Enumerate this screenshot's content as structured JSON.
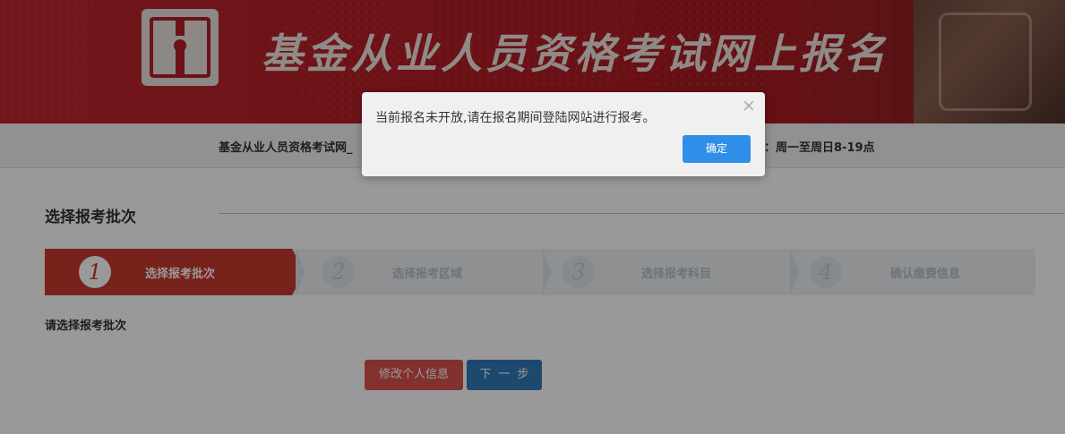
{
  "banner": {
    "title": "基金从业人员资格考试网上报名"
  },
  "infobar": {
    "left_text": "基金从业人员资格考试网_",
    "right_text": "服：周一至周日8-19点"
  },
  "section": {
    "title": "选择报考批次"
  },
  "steps": [
    {
      "num": "1",
      "label": "选择报考批次",
      "active": true
    },
    {
      "num": "2",
      "label": "选择报考区域",
      "active": false
    },
    {
      "num": "3",
      "label": "选择报考科目",
      "active": false
    },
    {
      "num": "4",
      "label": "确认缴费信息",
      "active": false
    }
  ],
  "prompt": "请选择报考批次",
  "buttons": {
    "edit_profile": "修改个人信息",
    "next": "下一步"
  },
  "dialog": {
    "message": "当前报名未开放,请在报名期间登陆网站进行报考。",
    "close_glyph": "×",
    "confirm": "确定"
  },
  "colors": {
    "banner_red": "#b21e27",
    "step_active": "#c8392f",
    "btn_edit": "#d9534f",
    "btn_next": "#337ab7",
    "dialog_confirm": "#2f8ee8"
  }
}
